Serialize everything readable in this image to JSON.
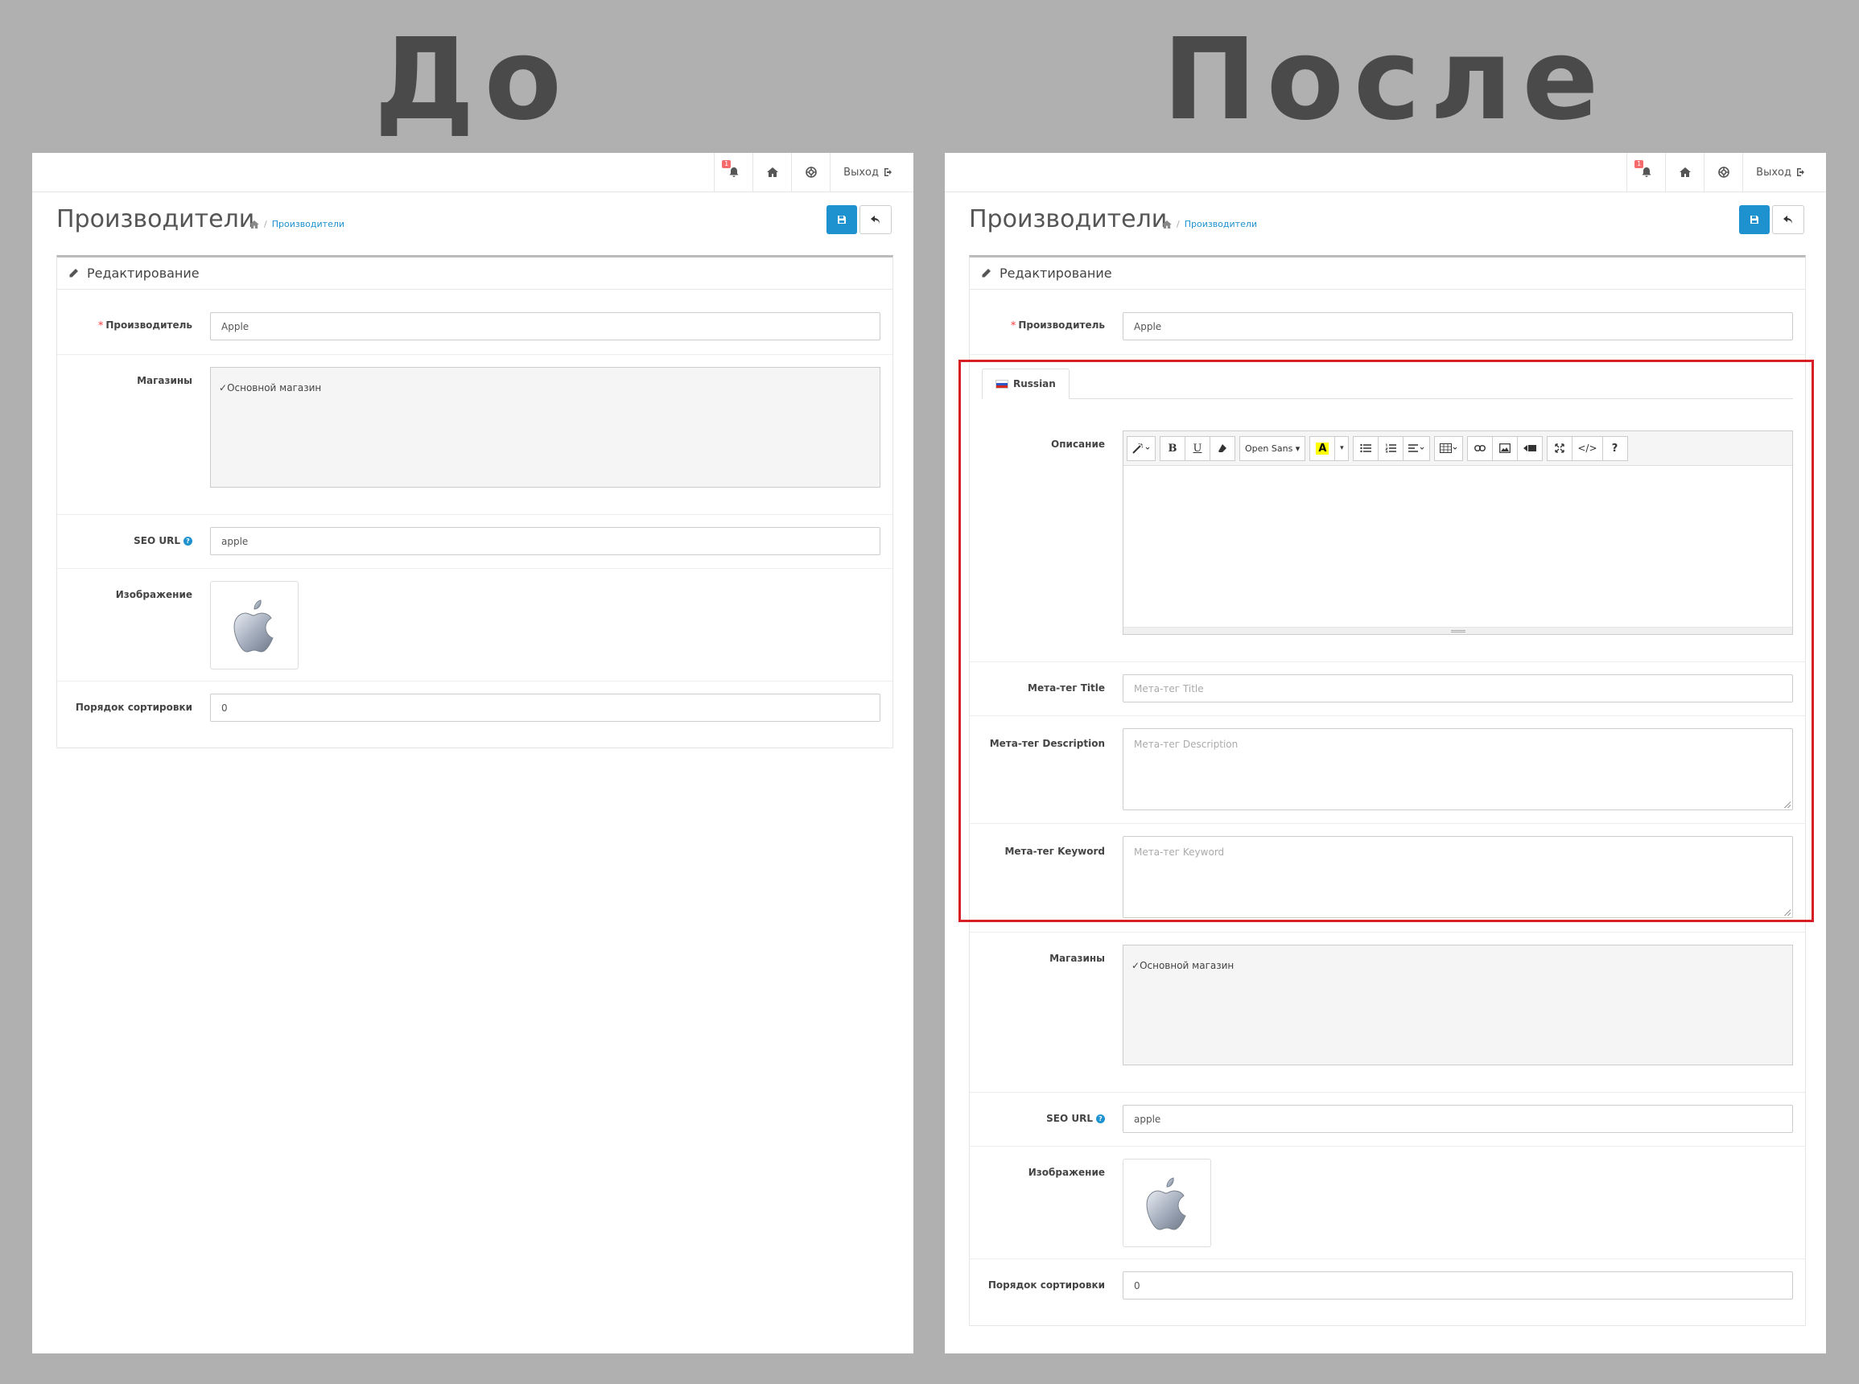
{
  "headings": {
    "before": "До",
    "after": "После"
  },
  "topnav": {
    "badge": "1",
    "logout_label": "Выход"
  },
  "page": {
    "title": "Производители",
    "breadcrumb": "Производители"
  },
  "card": {
    "title": "Редактирование"
  },
  "fields": {
    "manufacturer": {
      "label": "Производитель",
      "value": "Apple"
    },
    "stores": {
      "label": "Магазины",
      "option": "Основной магазин"
    },
    "seo_url": {
      "label": "SEO URL",
      "value": "apple"
    },
    "image": {
      "label": "Изображение"
    },
    "sort_order": {
      "label": "Порядок сортировки",
      "value": "0"
    }
  },
  "lang_tab": {
    "label": "Russian"
  },
  "description": {
    "label": "Описание",
    "font_name": "Open Sans"
  },
  "meta": {
    "title": {
      "label": "Мета-тег Title",
      "placeholder": "Мета-тег Title"
    },
    "description": {
      "label": "Мета-тег Description",
      "placeholder": "Мета-тег Description"
    },
    "keyword": {
      "label": "Мета-тег Keyword",
      "placeholder": "Мета-тег Keyword"
    }
  },
  "colors": {
    "primary": "#1e91cf",
    "highlight": "#d61f26",
    "badge": "#f56b6b"
  }
}
